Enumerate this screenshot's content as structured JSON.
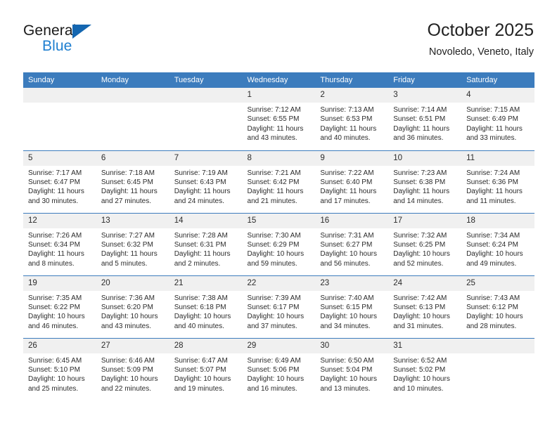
{
  "brand": {
    "name_top": "General",
    "name_bottom": "Blue",
    "triangle_color": "#1466b0",
    "blue_color": "#1f7fd0"
  },
  "header": {
    "title": "October 2025",
    "subtitle": "Novoledo, Veneto, Italy"
  },
  "theme": {
    "header_blue": "#3c7cbd",
    "daynum_gray": "#f0f0f0",
    "text": "#2b2b2b"
  },
  "weekday_headers": [
    "Sunday",
    "Monday",
    "Tuesday",
    "Wednesday",
    "Thursday",
    "Friday",
    "Saturday"
  ],
  "labels": {
    "sunrise": "Sunrise:",
    "sunset": "Sunset:",
    "daylight": "Daylight:"
  },
  "weeks": [
    [
      {
        "day": "",
        "empty": true
      },
      {
        "day": "",
        "empty": true
      },
      {
        "day": "",
        "empty": true
      },
      {
        "day": "1",
        "sunrise": "Sunrise: 7:12 AM",
        "sunset": "Sunset: 6:55 PM",
        "daylight_1": "Daylight: 11 hours",
        "daylight_2": "and 43 minutes."
      },
      {
        "day": "2",
        "sunrise": "Sunrise: 7:13 AM",
        "sunset": "Sunset: 6:53 PM",
        "daylight_1": "Daylight: 11 hours",
        "daylight_2": "and 40 minutes."
      },
      {
        "day": "3",
        "sunrise": "Sunrise: 7:14 AM",
        "sunset": "Sunset: 6:51 PM",
        "daylight_1": "Daylight: 11 hours",
        "daylight_2": "and 36 minutes."
      },
      {
        "day": "4",
        "sunrise": "Sunrise: 7:15 AM",
        "sunset": "Sunset: 6:49 PM",
        "daylight_1": "Daylight: 11 hours",
        "daylight_2": "and 33 minutes."
      }
    ],
    [
      {
        "day": "5",
        "sunrise": "Sunrise: 7:17 AM",
        "sunset": "Sunset: 6:47 PM",
        "daylight_1": "Daylight: 11 hours",
        "daylight_2": "and 30 minutes."
      },
      {
        "day": "6",
        "sunrise": "Sunrise: 7:18 AM",
        "sunset": "Sunset: 6:45 PM",
        "daylight_1": "Daylight: 11 hours",
        "daylight_2": "and 27 minutes."
      },
      {
        "day": "7",
        "sunrise": "Sunrise: 7:19 AM",
        "sunset": "Sunset: 6:43 PM",
        "daylight_1": "Daylight: 11 hours",
        "daylight_2": "and 24 minutes."
      },
      {
        "day": "8",
        "sunrise": "Sunrise: 7:21 AM",
        "sunset": "Sunset: 6:42 PM",
        "daylight_1": "Daylight: 11 hours",
        "daylight_2": "and 21 minutes."
      },
      {
        "day": "9",
        "sunrise": "Sunrise: 7:22 AM",
        "sunset": "Sunset: 6:40 PM",
        "daylight_1": "Daylight: 11 hours",
        "daylight_2": "and 17 minutes."
      },
      {
        "day": "10",
        "sunrise": "Sunrise: 7:23 AM",
        "sunset": "Sunset: 6:38 PM",
        "daylight_1": "Daylight: 11 hours",
        "daylight_2": "and 14 minutes."
      },
      {
        "day": "11",
        "sunrise": "Sunrise: 7:24 AM",
        "sunset": "Sunset: 6:36 PM",
        "daylight_1": "Daylight: 11 hours",
        "daylight_2": "and 11 minutes."
      }
    ],
    [
      {
        "day": "12",
        "sunrise": "Sunrise: 7:26 AM",
        "sunset": "Sunset: 6:34 PM",
        "daylight_1": "Daylight: 11 hours",
        "daylight_2": "and 8 minutes."
      },
      {
        "day": "13",
        "sunrise": "Sunrise: 7:27 AM",
        "sunset": "Sunset: 6:32 PM",
        "daylight_1": "Daylight: 11 hours",
        "daylight_2": "and 5 minutes."
      },
      {
        "day": "14",
        "sunrise": "Sunrise: 7:28 AM",
        "sunset": "Sunset: 6:31 PM",
        "daylight_1": "Daylight: 11 hours",
        "daylight_2": "and 2 minutes."
      },
      {
        "day": "15",
        "sunrise": "Sunrise: 7:30 AM",
        "sunset": "Sunset: 6:29 PM",
        "daylight_1": "Daylight: 10 hours",
        "daylight_2": "and 59 minutes."
      },
      {
        "day": "16",
        "sunrise": "Sunrise: 7:31 AM",
        "sunset": "Sunset: 6:27 PM",
        "daylight_1": "Daylight: 10 hours",
        "daylight_2": "and 56 minutes."
      },
      {
        "day": "17",
        "sunrise": "Sunrise: 7:32 AM",
        "sunset": "Sunset: 6:25 PM",
        "daylight_1": "Daylight: 10 hours",
        "daylight_2": "and 52 minutes."
      },
      {
        "day": "18",
        "sunrise": "Sunrise: 7:34 AM",
        "sunset": "Sunset: 6:24 PM",
        "daylight_1": "Daylight: 10 hours",
        "daylight_2": "and 49 minutes."
      }
    ],
    [
      {
        "day": "19",
        "sunrise": "Sunrise: 7:35 AM",
        "sunset": "Sunset: 6:22 PM",
        "daylight_1": "Daylight: 10 hours",
        "daylight_2": "and 46 minutes."
      },
      {
        "day": "20",
        "sunrise": "Sunrise: 7:36 AM",
        "sunset": "Sunset: 6:20 PM",
        "daylight_1": "Daylight: 10 hours",
        "daylight_2": "and 43 minutes."
      },
      {
        "day": "21",
        "sunrise": "Sunrise: 7:38 AM",
        "sunset": "Sunset: 6:18 PM",
        "daylight_1": "Daylight: 10 hours",
        "daylight_2": "and 40 minutes."
      },
      {
        "day": "22",
        "sunrise": "Sunrise: 7:39 AM",
        "sunset": "Sunset: 6:17 PM",
        "daylight_1": "Daylight: 10 hours",
        "daylight_2": "and 37 minutes."
      },
      {
        "day": "23",
        "sunrise": "Sunrise: 7:40 AM",
        "sunset": "Sunset: 6:15 PM",
        "daylight_1": "Daylight: 10 hours",
        "daylight_2": "and 34 minutes."
      },
      {
        "day": "24",
        "sunrise": "Sunrise: 7:42 AM",
        "sunset": "Sunset: 6:13 PM",
        "daylight_1": "Daylight: 10 hours",
        "daylight_2": "and 31 minutes."
      },
      {
        "day": "25",
        "sunrise": "Sunrise: 7:43 AM",
        "sunset": "Sunset: 6:12 PM",
        "daylight_1": "Daylight: 10 hours",
        "daylight_2": "and 28 minutes."
      }
    ],
    [
      {
        "day": "26",
        "sunrise": "Sunrise: 6:45 AM",
        "sunset": "Sunset: 5:10 PM",
        "daylight_1": "Daylight: 10 hours",
        "daylight_2": "and 25 minutes."
      },
      {
        "day": "27",
        "sunrise": "Sunrise: 6:46 AM",
        "sunset": "Sunset: 5:09 PM",
        "daylight_1": "Daylight: 10 hours",
        "daylight_2": "and 22 minutes."
      },
      {
        "day": "28",
        "sunrise": "Sunrise: 6:47 AM",
        "sunset": "Sunset: 5:07 PM",
        "daylight_1": "Daylight: 10 hours",
        "daylight_2": "and 19 minutes."
      },
      {
        "day": "29",
        "sunrise": "Sunrise: 6:49 AM",
        "sunset": "Sunset: 5:06 PM",
        "daylight_1": "Daylight: 10 hours",
        "daylight_2": "and 16 minutes."
      },
      {
        "day": "30",
        "sunrise": "Sunrise: 6:50 AM",
        "sunset": "Sunset: 5:04 PM",
        "daylight_1": "Daylight: 10 hours",
        "daylight_2": "and 13 minutes."
      },
      {
        "day": "31",
        "sunrise": "Sunrise: 6:52 AM",
        "sunset": "Sunset: 5:02 PM",
        "daylight_1": "Daylight: 10 hours",
        "daylight_2": "and 10 minutes."
      },
      {
        "day": "",
        "empty": true
      }
    ]
  ]
}
